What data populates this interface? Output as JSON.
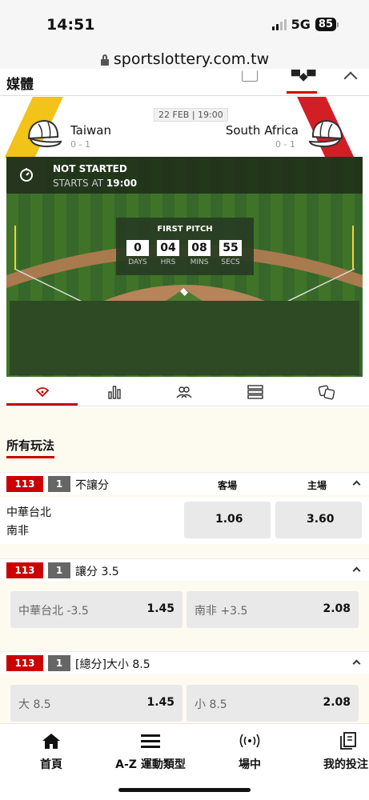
{
  "status_bar": {
    "time": "14:51",
    "network": "5G",
    "battery": "85"
  },
  "browser": {
    "url": "sportslottery.com.tw"
  },
  "media": {
    "title": "媒體"
  },
  "match": {
    "date": "22 FEB | 19:00",
    "home": {
      "name": "Taiwan",
      "record": "0 - 1",
      "color": "#f2c318"
    },
    "away": {
      "name": "South Africa",
      "record": "0 - 1",
      "color": "#d21f26"
    },
    "status": "NOT STARTED",
    "starts_at_label": "STARTS AT",
    "starts_at_time": "19:00",
    "countdown_title": "FIRST PITCH",
    "countdown": [
      {
        "value": "0",
        "label": "DAYS"
      },
      {
        "value": "04",
        "label": "HRS"
      },
      {
        "value": "08",
        "label": "MINS"
      },
      {
        "value": "55",
        "label": "SECS"
      }
    ]
  },
  "icon_tabs": [
    "field-icon",
    "stats-icon",
    "lineup-icon",
    "list-icon",
    "dice-icon"
  ],
  "section": {
    "title": "所有玩法"
  },
  "markets": {
    "moneyline": {
      "code": "113",
      "num": "1",
      "title": "不讓分",
      "col_away": "客場",
      "col_home": "主場",
      "team1": "中華台北",
      "team2": "南非",
      "odd_away": "1.06",
      "odd_home": "3.60"
    },
    "handicap": {
      "code": "113",
      "num": "1",
      "title": "讓分 3.5",
      "left_label": "中華台北 -3.5",
      "left_odd": "1.45",
      "right_label": "南非 +3.5",
      "right_odd": "2.08"
    },
    "total": {
      "code": "113",
      "num": "1",
      "title": "[總分]大小 8.5",
      "left_label": "大 8.5",
      "left_odd": "1.45",
      "right_label": "小 8.5",
      "right_odd": "2.08"
    }
  },
  "bottom_nav": {
    "home": "首頁",
    "sports": "A-Z 運動類型",
    "live": "場中",
    "mybets": "我的投注"
  },
  "colors": {
    "accent": "#cc0000",
    "field": "#3b6d25"
  }
}
